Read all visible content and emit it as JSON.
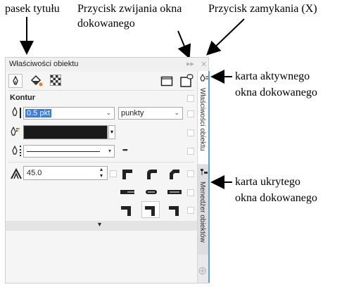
{
  "annotations": {
    "title_bar": "pasek tytułu",
    "collapse_button_1": "Przycisk zwijania okna",
    "collapse_button_2": "dokowanego",
    "close_button": "Przycisk zamykania (X)",
    "active_tab_1": "karta aktywnego",
    "active_tab_2": "okna dokowanego",
    "hidden_tab_1": "karta ukrytego",
    "hidden_tab_2": "okna dokowanego"
  },
  "docker": {
    "title": "Właściwości obiektu",
    "collapse_glyph": "▸▸",
    "close_glyph": "✕",
    "section_label": "Kontur",
    "width_value": "0.5 pkt",
    "units_value": "punkty",
    "miter_value": "45.0",
    "line_style_more": "▪▪▪",
    "expand_arrow": "▾",
    "add_glyph": "⊕"
  },
  "tabs": {
    "active": "Właściwości obiektu",
    "hidden": "Menedżer obiektów"
  },
  "colors": {
    "outline_color": "#1a1a1a",
    "accent": "#5aa0dc",
    "selection": "#3b7ddd"
  },
  "icons": [
    "pen-outline-icon",
    "fill-bucket-icon",
    "transparency-checker-icon",
    "frame-icon",
    "copy-properties-icon",
    "corner-miter-icon",
    "corner-round-icon",
    "corner-bevel-icon",
    "line-cap-butt-icon",
    "line-cap-round-icon",
    "line-cap-square-icon",
    "position-outside-icon",
    "position-center-icon",
    "position-inside-icon"
  ]
}
